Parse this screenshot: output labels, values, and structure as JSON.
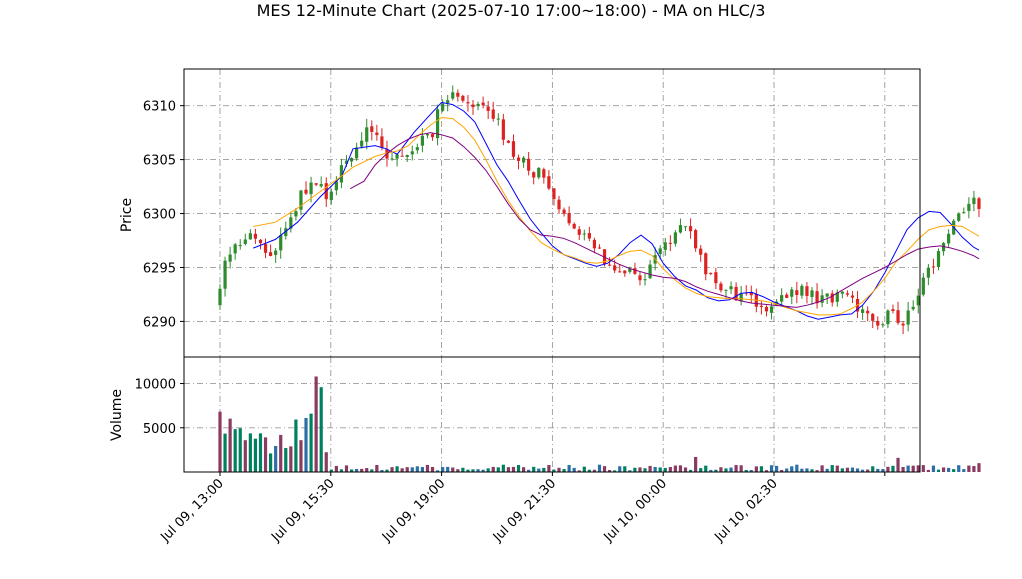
{
  "chart_data": {
    "type": "candlestick",
    "title": "MES 12-Minute Chart (2025-07-10 17:00~18:00) - MA on HLC/3",
    "price_panel": {
      "ylabel": "Price",
      "ylim": [
        6286.7,
        6313.4
      ],
      "yticks": [
        6290,
        6295,
        6300,
        6305,
        6310
      ],
      "grid": true
    },
    "volume_panel": {
      "ylabel": "Volume",
      "ylim": [
        0,
        13000
      ],
      "yticks": [
        5000,
        10000
      ],
      "grid": true
    },
    "x_tick_labels": [
      "Jul 09, 13:00",
      "Jul 09, 15:30",
      "Jul 09, 19:00",
      "Jul 09, 21:30",
      "Jul 10, 00:00",
      "Jul 10, 02:30"
    ],
    "bar_count": 151,
    "price_path": [
      [
        0,
        6291.5
      ],
      [
        2,
        6296.5
      ],
      [
        6,
        6298.5
      ],
      [
        10,
        6296.5
      ],
      [
        12,
        6297
      ],
      [
        14,
        6299
      ],
      [
        18,
        6303
      ],
      [
        22,
        6301.5
      ],
      [
        24,
        6304
      ],
      [
        26,
        6305
      ],
      [
        28,
        6306.5
      ],
      [
        30,
        6309
      ],
      [
        32,
        6306
      ],
      [
        34,
        6305
      ],
      [
        36,
        6306
      ],
      [
        38,
        6305.5
      ],
      [
        40,
        6306.5
      ],
      [
        42,
        6307
      ],
      [
        44,
        6310
      ],
      [
        46,
        6311.5
      ],
      [
        48,
        6310.5
      ],
      [
        50,
        6310
      ],
      [
        52,
        6310
      ],
      [
        54,
        6309.5
      ],
      [
        56,
        6308
      ],
      [
        58,
        6306
      ],
      [
        60,
        6305
      ],
      [
        62,
        6304
      ],
      [
        64,
        6303.5
      ],
      [
        66,
        6301
      ],
      [
        68,
        6300
      ],
      [
        70,
        6299.5
      ],
      [
        72,
        6298
      ],
      [
        74,
        6297
      ],
      [
        76,
        6296
      ],
      [
        78,
        6295.5
      ],
      [
        80,
        6295
      ],
      [
        82,
        6294.5
      ],
      [
        84,
        6294
      ],
      [
        86,
        6295.5
      ],
      [
        88,
        6297
      ],
      [
        90,
        6298
      ],
      [
        92,
        6298.5
      ],
      [
        94,
        6298
      ],
      [
        96,
        6295
      ],
      [
        98,
        6293.5
      ],
      [
        100,
        6293
      ],
      [
        104,
        6292
      ],
      [
        108,
        6291.5
      ],
      [
        112,
        6292
      ],
      [
        116,
        6293
      ],
      [
        118,
        6292
      ],
      [
        120,
        6292.5
      ],
      [
        124,
        6292
      ],
      [
        128,
        6291
      ],
      [
        130,
        6290
      ],
      [
        132,
        6290.5
      ],
      [
        134,
        6290.5
      ],
      [
        136,
        6290
      ],
      [
        138,
        6292
      ],
      [
        140,
        6294
      ],
      [
        142,
        6296
      ],
      [
        144,
        6298
      ],
      [
        146,
        6299.5
      ],
      [
        148,
        6300.5
      ],
      [
        150,
        6301
      ],
      [
        152,
        6299.5
      ],
      [
        154,
        6297
      ],
      [
        156,
        6296
      ],
      [
        158,
        6296.5
      ],
      [
        160,
        6297.5
      ]
    ],
    "series": [
      {
        "name": "",
        "color": "#0000ff",
        "points": [
          [
            6,
            6296.8
          ],
          [
            10,
            6297.6
          ],
          [
            14,
            6299.2
          ],
          [
            18,
            6301.5
          ],
          [
            22,
            6303.5
          ],
          [
            24,
            6306
          ],
          [
            28,
            6306.3
          ],
          [
            30,
            6306
          ],
          [
            32,
            6305.5
          ],
          [
            35,
            6307.5
          ],
          [
            38,
            6309.2
          ],
          [
            40,
            6310.3
          ],
          [
            42,
            6310.1
          ],
          [
            44,
            6309.5
          ],
          [
            46,
            6308.5
          ],
          [
            48,
            6306.5
          ],
          [
            50,
            6304.5
          ],
          [
            52,
            6303
          ],
          [
            54,
            6301.2
          ],
          [
            56,
            6299.5
          ],
          [
            58,
            6298.2
          ],
          [
            60,
            6297
          ],
          [
            62,
            6296.2
          ],
          [
            64,
            6295.8
          ],
          [
            66,
            6295.4
          ],
          [
            68,
            6295.1
          ],
          [
            70,
            6295.4
          ],
          [
            72,
            6296.2
          ],
          [
            74,
            6297.3
          ],
          [
            76,
            6298
          ],
          [
            78,
            6297.2
          ],
          [
            80,
            6295.4
          ],
          [
            82,
            6294.2
          ],
          [
            84,
            6293.3
          ],
          [
            86,
            6292.9
          ],
          [
            88,
            6292.2
          ],
          [
            90,
            6291.9
          ],
          [
            92,
            6292
          ],
          [
            94,
            6292.6
          ],
          [
            96,
            6292.7
          ],
          [
            98,
            6292.3
          ],
          [
            100,
            6291.8
          ],
          [
            102,
            6291.4
          ],
          [
            104,
            6291
          ],
          [
            106,
            6290.5
          ],
          [
            108,
            6290.2
          ],
          [
            110,
            6290.4
          ],
          [
            112,
            6290.6
          ],
          [
            114,
            6290.7
          ],
          [
            116,
            6291.5
          ],
          [
            118,
            6292.8
          ],
          [
            120,
            6294.5
          ],
          [
            122,
            6296.5
          ],
          [
            124,
            6298.5
          ],
          [
            126,
            6299.6
          ],
          [
            128,
            6300.2
          ],
          [
            130,
            6300.1
          ],
          [
            132,
            6299
          ],
          [
            134,
            6297.8
          ],
          [
            136,
            6296.9
          ],
          [
            137,
            6296.6
          ]
        ]
      },
      {
        "name": "",
        "color": "#ffa500",
        "points": [
          [
            6,
            6298.8
          ],
          [
            10,
            6299.2
          ],
          [
            14,
            6300.5
          ],
          [
            18,
            6302
          ],
          [
            22,
            6303.5
          ],
          [
            24,
            6304.3
          ],
          [
            28,
            6305.3
          ],
          [
            30,
            6305.6
          ],
          [
            32,
            6305.8
          ],
          [
            34,
            6306.3
          ],
          [
            36,
            6307.3
          ],
          [
            38,
            6308.2
          ],
          [
            40,
            6308.9
          ],
          [
            42,
            6308.8
          ],
          [
            44,
            6308
          ],
          [
            46,
            6306.8
          ],
          [
            48,
            6305
          ],
          [
            50,
            6303
          ],
          [
            52,
            6301.2
          ],
          [
            54,
            6299.7
          ],
          [
            56,
            6298.4
          ],
          [
            58,
            6297.3
          ],
          [
            60,
            6296.7
          ],
          [
            62,
            6296.2
          ],
          [
            64,
            6295.9
          ],
          [
            66,
            6295.5
          ],
          [
            68,
            6295.4
          ],
          [
            70,
            6295.6
          ],
          [
            72,
            6296.1
          ],
          [
            74,
            6296.5
          ],
          [
            76,
            6296.6
          ],
          [
            78,
            6296.1
          ],
          [
            80,
            6294.9
          ],
          [
            82,
            6293.9
          ],
          [
            84,
            6293.1
          ],
          [
            86,
            6292.6
          ],
          [
            88,
            6292.3
          ],
          [
            90,
            6292.2
          ],
          [
            92,
            6292.1
          ],
          [
            94,
            6292.1
          ],
          [
            96,
            6292
          ],
          [
            98,
            6291.9
          ],
          [
            100,
            6291.7
          ],
          [
            102,
            6291.3
          ],
          [
            104,
            6291
          ],
          [
            106,
            6290.8
          ],
          [
            108,
            6290.6
          ],
          [
            110,
            6290.6
          ],
          [
            112,
            6290.7
          ],
          [
            114,
            6291.2
          ],
          [
            116,
            6291.8
          ],
          [
            118,
            6292.8
          ],
          [
            120,
            6294
          ],
          [
            122,
            6295.5
          ],
          [
            124,
            6296.5
          ],
          [
            126,
            6297.6
          ],
          [
            128,
            6298.5
          ],
          [
            130,
            6298.8
          ],
          [
            132,
            6298.9
          ],
          [
            134,
            6298.8
          ],
          [
            136,
            6298.2
          ],
          [
            137,
            6297.9
          ]
        ]
      },
      {
        "name": "",
        "color": "#800080",
        "points": [
          [
            23.5,
            6302.3
          ],
          [
            26,
            6303
          ],
          [
            28,
            6304.5
          ],
          [
            30,
            6305.5
          ],
          [
            32,
            6306.3
          ],
          [
            34,
            6306.9
          ],
          [
            36,
            6307.3
          ],
          [
            38,
            6307.5
          ],
          [
            40,
            6307.3
          ],
          [
            42,
            6307
          ],
          [
            44,
            6306.2
          ],
          [
            46,
            6305.2
          ],
          [
            48,
            6304
          ],
          [
            50,
            6302.5
          ],
          [
            52,
            6300.9
          ],
          [
            54,
            6299.5
          ],
          [
            56,
            6298.5
          ],
          [
            58,
            6298
          ],
          [
            60,
            6297.9
          ],
          [
            62,
            6297.7
          ],
          [
            64,
            6297.3
          ],
          [
            66,
            6296.8
          ],
          [
            68,
            6296.3
          ],
          [
            70,
            6295.8
          ],
          [
            72,
            6295.3
          ],
          [
            74,
            6294.9
          ],
          [
            76,
            6294.6
          ],
          [
            78,
            6294.3
          ],
          [
            80,
            6294.1
          ],
          [
            82,
            6294
          ],
          [
            84,
            6293.7
          ],
          [
            86,
            6293.2
          ],
          [
            88,
            6292.8
          ],
          [
            90,
            6292.5
          ],
          [
            92,
            6292.2
          ],
          [
            94,
            6291.9
          ],
          [
            96,
            6291.7
          ],
          [
            98,
            6291.6
          ],
          [
            100,
            6291.5
          ],
          [
            102,
            6291.4
          ],
          [
            104,
            6291.3
          ],
          [
            106,
            6291.5
          ],
          [
            108,
            6291.8
          ],
          [
            110,
            6292.2
          ],
          [
            112,
            6292.8
          ],
          [
            114,
            6293.4
          ],
          [
            116,
            6294
          ],
          [
            118,
            6294.5
          ],
          [
            120,
            6295
          ],
          [
            122,
            6295.6
          ],
          [
            124,
            6296.2
          ],
          [
            126,
            6296.7
          ],
          [
            128,
            6296.9
          ],
          [
            130,
            6297
          ],
          [
            132,
            6296.8
          ],
          [
            134,
            6296.5
          ],
          [
            136,
            6296.1
          ],
          [
            137,
            6295.8
          ]
        ]
      }
    ],
    "up_color": "#2e8b2e",
    "down_color": "#dd2222",
    "volume_colors": [
      "#008060",
      "#8b3a62",
      "#2a6fa8"
    ]
  }
}
